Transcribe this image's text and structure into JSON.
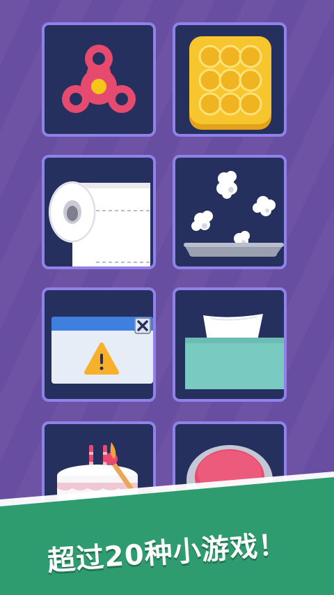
{
  "banner": {
    "text": "超过20种小游戏！",
    "color": "#2e9c6e"
  },
  "games": [
    {
      "icon": "fidget-spinner-icon"
    },
    {
      "icon": "pop-it-icon"
    },
    {
      "icon": "toilet-paper-icon"
    },
    {
      "icon": "popcorn-icon"
    },
    {
      "icon": "error-dialog-icon"
    },
    {
      "icon": "tissue-box-icon"
    },
    {
      "icon": "birthday-cake-match-icon"
    },
    {
      "icon": "red-button-icon"
    }
  ],
  "colors": {
    "background": "#6a4fa3",
    "tile": "#26305e",
    "tile_border": "#8f82e8"
  }
}
